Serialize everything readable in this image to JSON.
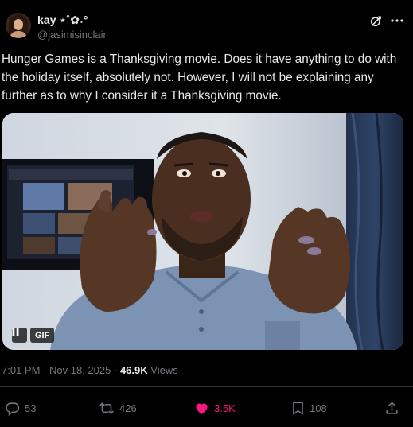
{
  "author": {
    "display_name": "kay ⋆˚✿˖°",
    "handle": "@jasimisinclair",
    "avatar_icon": "profile-photo"
  },
  "header_icons": {
    "grok": "grok-icon",
    "more": "more-options-icon",
    "more_glyph": "···"
  },
  "tweet": {
    "text": "Hunger Games is a Thanksgiving movie. Does it have anything to do with the holiday itself, absolutely not. However, I will not be explaining any further as to why I consider it a Thanksgiving movie."
  },
  "media": {
    "type": "gif",
    "badge": "GIF",
    "pause_icon": "pause-icon"
  },
  "meta": {
    "time": "7:01 PM",
    "separator": "·",
    "date": "Nov 18, 2025",
    "views_count": "46.9K",
    "views_label": "Views"
  },
  "actions": {
    "replies": "53",
    "reposts": "426",
    "likes": "3.5K",
    "bookmarks": "108"
  },
  "colors": {
    "background": "#000000",
    "text_primary": "#e7e9ea",
    "text_secondary": "#71767b",
    "like_active": "#f91880",
    "divider": "#2f3336"
  }
}
